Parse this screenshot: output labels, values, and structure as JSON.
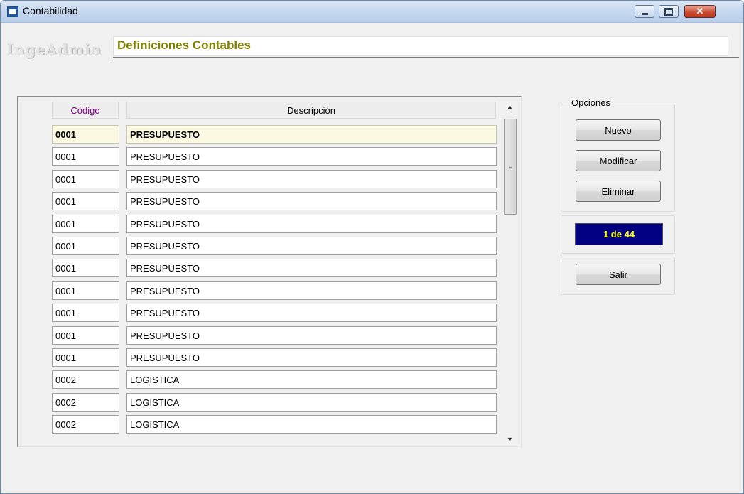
{
  "window": {
    "title": "Contabilidad"
  },
  "brand": "IngeAdmin",
  "section_title": "Definiciones Contables",
  "grid": {
    "columns": [
      "Código",
      "Descripción"
    ],
    "rows": [
      [
        "0001",
        "PRESUPUESTO"
      ],
      [
        "0001",
        "PRESUPUESTO"
      ],
      [
        "0001",
        "PRESUPUESTO"
      ],
      [
        "0001",
        "PRESUPUESTO"
      ],
      [
        "0001",
        "PRESUPUESTO"
      ],
      [
        "0001",
        "PRESUPUESTO"
      ],
      [
        "0001",
        "PRESUPUESTO"
      ],
      [
        "0001",
        "PRESUPUESTO"
      ],
      [
        "0001",
        "PRESUPUESTO"
      ],
      [
        "0001",
        "PRESUPUESTO"
      ],
      [
        "0001",
        "PRESUPUESTO"
      ],
      [
        "0002",
        "LOGISTICA"
      ],
      [
        "0002",
        "LOGISTICA"
      ],
      [
        "0002",
        "LOGISTICA"
      ]
    ]
  },
  "options": {
    "legend": "Opciones",
    "nuevo": "Nuevo",
    "modificar": "Modificar",
    "eliminar": "Eliminar"
  },
  "record_counter": "1 de 44",
  "exit_label": "Salir",
  "colors": {
    "section_title": "#808000",
    "code_header": "#800080",
    "counter_bg": "#000080",
    "counter_text": "#ffff00",
    "active_row_bg": "#fbf9e1"
  },
  "icons": {
    "window": "app-window-icon",
    "minimize": "minimize-icon",
    "maximize": "maximize-icon",
    "close": "close-icon",
    "scroll_up": "arrow-up-icon",
    "scroll_down": "arrow-down-icon"
  }
}
